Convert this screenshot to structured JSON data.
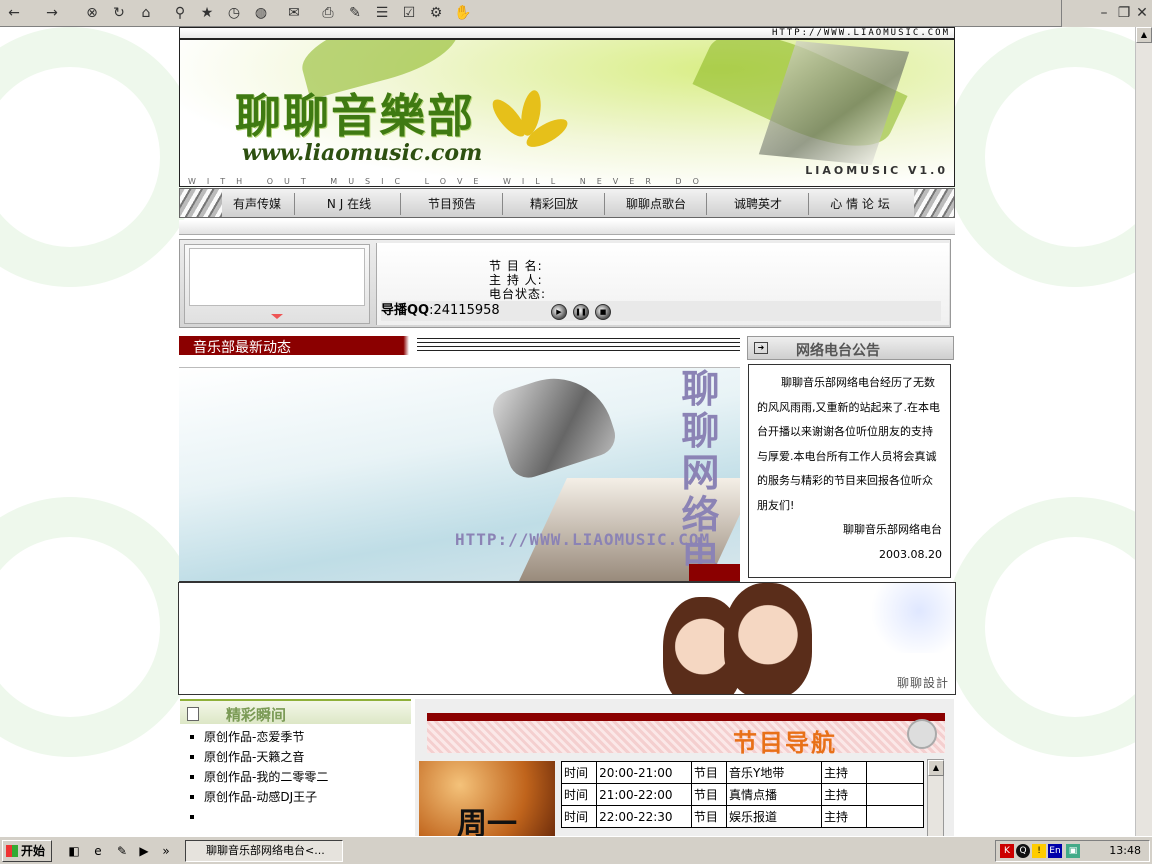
{
  "browser": {
    "toolbar_icons": [
      "back-icon",
      "forward-icon",
      "stop-icon",
      "refresh-icon",
      "home-icon",
      "search-icon",
      "favorites-icon",
      "history-icon",
      "channels-icon",
      "mail-icon",
      "print-icon",
      "edit-icon",
      "discuss-icon",
      "messenger-icon",
      "tools-icon",
      "related-icon"
    ]
  },
  "header": {
    "url_strip": "HTTP://WWW.LIAOMUSIC.COM",
    "logo": "聊聊音樂部",
    "site_url": "www.liaomusic.com",
    "version": "LIAOMUSIC V1.0",
    "motto": "WITH OUT MUSIC LOVE WILL NEVER DO"
  },
  "nav": {
    "items": [
      "有声传媒",
      "N J 在线",
      "节目预告",
      "精彩回放",
      "聊聊点歌台",
      "诚聘英才",
      "心 情 论 坛"
    ]
  },
  "player": {
    "program_label": "节 目 名:",
    "host_label": "主 持 人:",
    "status_label": "电台状态:",
    "qq_label": "导播QQ",
    "qq_value": ":24115958"
  },
  "news": {
    "title": "音乐部最新动态",
    "image_text": "聊聊网络电台",
    "image_url": "HTTP://WWW.LIAOMUSIC.COM"
  },
  "announcement": {
    "title": "网络电台公告",
    "body": "聊聊音乐部网络电台经历了无数的风风雨雨,又重新的站起来了.在本电台开播以来谢谢各位听位朋友的支持与厚爱.本电台所有工作人员将会真诚的服务与精彩的节目来回报各位听众朋友们!",
    "signature": "聊聊音乐部网络电台",
    "date": "2003.08.20"
  },
  "photo": {
    "signature": "聊聊設計"
  },
  "highlights": {
    "title": "精彩瞬间",
    "items": [
      "原创作品-恋爱季节",
      "原创作品-天籁之音",
      "原创作品-我的二零零二",
      "原创作品-动感DJ王子",
      ""
    ]
  },
  "program_guide": {
    "title": "节目导航",
    "day": "周一",
    "rows": [
      {
        "time_label": "时间",
        "time": "20:00-21:00",
        "prog_label": "节目",
        "program": "音乐Y地带",
        "host_label": "主持",
        "host": ""
      },
      {
        "time_label": "时间",
        "time": "21:00-22:00",
        "prog_label": "节目",
        "program": "真情点播",
        "host_label": "主持",
        "host": ""
      },
      {
        "time_label": "时间",
        "time": "22:00-22:30",
        "prog_label": "节目",
        "program": "娱乐报道",
        "host_label": "主持",
        "host": ""
      }
    ]
  },
  "taskbar": {
    "start": "开始",
    "window_title": "聊聊音乐部网络电台<...",
    "chevron": "»",
    "clock": "13:48",
    "tray_lang": "En"
  }
}
